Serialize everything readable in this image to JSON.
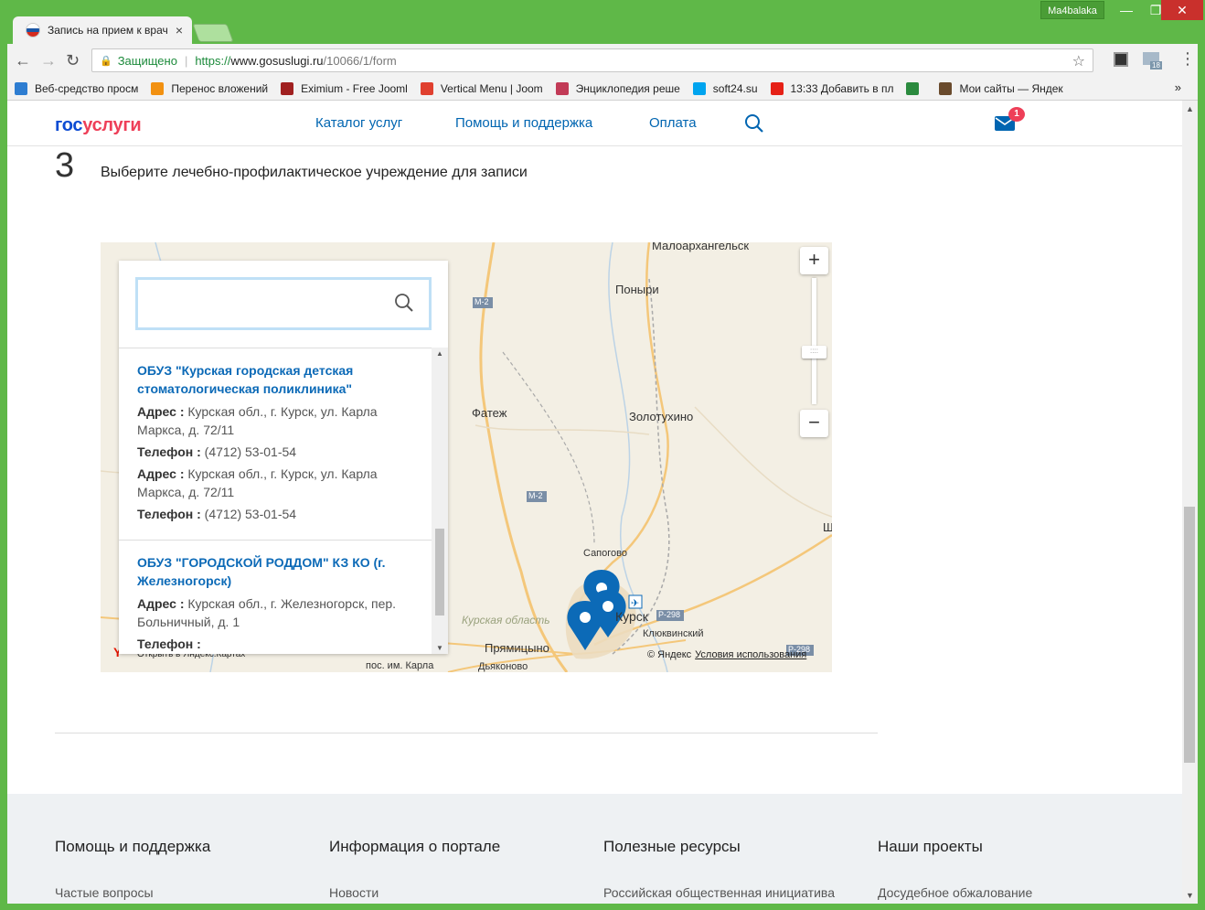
{
  "browser": {
    "tab_title": "Запись на прием к врач",
    "tab_close": "×",
    "user_badge": "Ma4balaka",
    "win_min": "—",
    "win_max": "❐",
    "win_close": "✕",
    "secure_label": "Защищено",
    "url_scheme": "https://",
    "url_host": "www.gosuslugi.ru",
    "url_path": "/10066/1/form",
    "ext_badge": "18",
    "bookmarks": [
      {
        "label": "Веб-средство просм",
        "color": "#2e7dd1"
      },
      {
        "label": "Перенос вложений",
        "color": "#f29111"
      },
      {
        "label": "Eximium - Free Jooml",
        "color": "#a02020"
      },
      {
        "label": "Vertical Menu | Joom",
        "color": "#e0402f"
      },
      {
        "label": "Энциклопедия реше",
        "color": "#c23b57"
      },
      {
        "label": "soft24.su",
        "color": "#00a4ef"
      },
      {
        "label": "13:33 Добавить в пл",
        "color": "#e62117"
      },
      {
        "label": "",
        "color": "#2b8a3e"
      },
      {
        "label": "Мои сайты — Яндек",
        "color": "#6a4b2d"
      }
    ],
    "bookmarks_more": "»"
  },
  "header": {
    "logo_part1": "гос",
    "logo_part2": "услуги",
    "nav": [
      "Каталог услуг",
      "Помощь и поддержка",
      "Оплата"
    ],
    "mail_count": "1"
  },
  "step": {
    "number": "3",
    "title": "Выберите лечебно-профилактическое учреждение для записи"
  },
  "map": {
    "search_placeholder": "",
    "zoom_in": "+",
    "zoom_out": "−",
    "labels": {
      "maloarkh": "Малоархангельск",
      "ponyri": "Поныри",
      "fatezh": "Фатеж",
      "zolotukhino": "Золотухино",
      "sapogovo": "Сапогово",
      "kursk": "Курск",
      "klyukvinsky": "Клюквинский",
      "pryamitsyno": "Прямицыно",
      "dyakonovo": "Дьяконово",
      "pos_karla": "пос. им. Карла",
      "region": "Курская область",
      "shch": "Щ"
    },
    "roads": {
      "m2a": "М-2",
      "m2b": "М-2",
      "r298a": "Р-298",
      "r298b": "Р-298"
    },
    "copyright": "© Яндекс",
    "terms": "Условия использования",
    "open_maps": "Открыть в Яндекс.Картах",
    "items": [
      {
        "name": "ОБУЗ \"Курская городская детская стоматологическая поликлиника\"",
        "addr_label": "Адрес :",
        "addr1": "Курская обл., г. Курск, ул. Карла Маркса, д. 72/11",
        "phone_label": "Телефон :",
        "phone1": "(4712) 53-01-54",
        "addr2": "Курская обл., г. Курск, ул. Карла Маркса, д. 72/11",
        "phone2": "(4712) 53-01-54"
      },
      {
        "name": "ОБУЗ \"ГОРОДСКОЙ РОДДОМ\" КЗ КО (г. Железногорск)",
        "addr_label": "Адрес :",
        "addr1": "Курская обл., г. Железногорск, пер. Больничный, д. 1",
        "phone_label": "Телефон :"
      }
    ]
  },
  "footer": {
    "columns": [
      {
        "heading": "Помощь и поддержка",
        "link": "Частые вопросы"
      },
      {
        "heading": "Информация о портале",
        "link": "Новости"
      },
      {
        "heading": "Полезные ресурсы",
        "link": "Российская общественная инициатива"
      },
      {
        "heading": "Наши проекты",
        "link": "Досудебное обжалование"
      }
    ]
  },
  "colors": {
    "window_frame": "#5fb848",
    "link_blue": "#0065b1",
    "logo_blue": "#0d4cd3",
    "logo_red": "#ee3f58",
    "marker_blue": "#0c6ab7"
  }
}
